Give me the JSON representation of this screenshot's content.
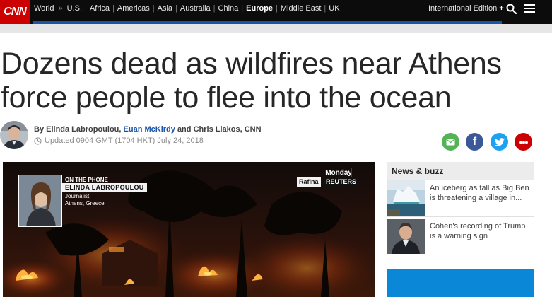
{
  "brand": {
    "logo_text": "CNN",
    "accent": "#cc0000",
    "nav_blue": "#1a56a8"
  },
  "nav": {
    "section": "World",
    "chevron": "»",
    "items": [
      {
        "label": "U.S.",
        "active": false
      },
      {
        "label": "Africa",
        "active": false
      },
      {
        "label": "Americas",
        "active": false
      },
      {
        "label": "Asia",
        "active": false
      },
      {
        "label": "Australia",
        "active": false
      },
      {
        "label": "China",
        "active": false
      },
      {
        "label": "Europe",
        "active": true
      },
      {
        "label": "Middle East",
        "active": false
      },
      {
        "label": "UK",
        "active": false
      }
    ],
    "edition_label": "International Edition",
    "edition_plus": "+",
    "search_icon": "search-icon",
    "menu_icon": "hamburger-menu-icon"
  },
  "article": {
    "headline": "Dozens dead as wildfires near Athens force people to flee into the ocean",
    "byline": {
      "prefix": "By",
      "author_1": "Elinda Labropoulou,",
      "author_2": "Euan McKirdy",
      "conjunction": "and",
      "author_3": "Chris Liakos, CNN"
    },
    "updated": "Updated 0904 GMT (1704 HKT) July 24, 2018",
    "share": [
      {
        "name": "email",
        "icon": "email-icon",
        "color": "#54b354"
      },
      {
        "name": "facebook",
        "icon": "facebook-icon",
        "glyph": "f",
        "color": "#3b5998"
      },
      {
        "name": "twitter",
        "icon": "twitter-icon",
        "color": "#1da1f2"
      },
      {
        "name": "more",
        "icon": "more-icon",
        "glyph": "•••",
        "color": "#cc0000"
      }
    ]
  },
  "video": {
    "on_phone": "ON THE PHONE",
    "guest_name": "ELINDA LABROPOULOU",
    "guest_role": "Journalist",
    "guest_location": "Athens, Greece",
    "day": "Monday",
    "place": "Rafina",
    "agency": "REUTERS"
  },
  "sidebar": {
    "title": "News & buzz",
    "items": [
      {
        "text": "An iceberg as tall as Big Ben is threatening a village in..."
      },
      {
        "text": "Cohen's recording of Trump is a warning sign"
      }
    ]
  }
}
